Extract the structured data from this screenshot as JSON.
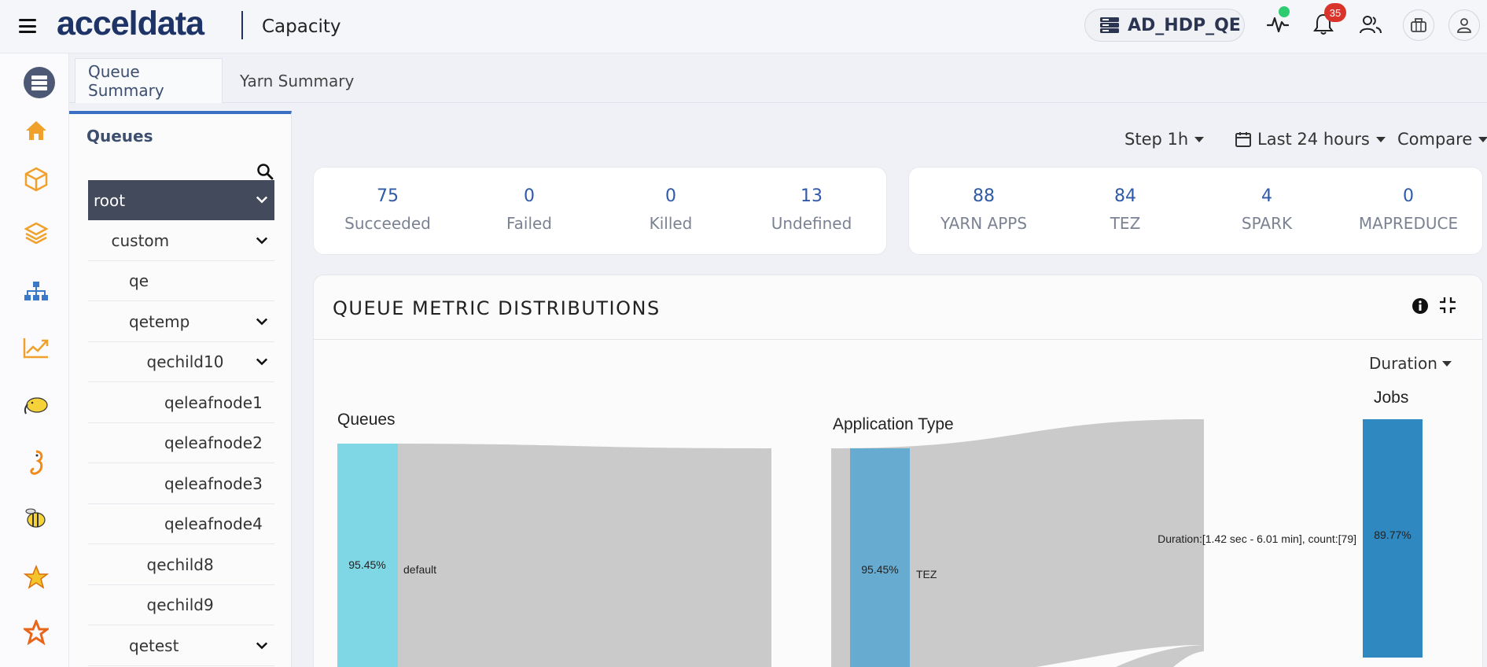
{
  "header": {
    "logo_text": "acceldata",
    "app_title": "Capacity",
    "cluster_name": "AD_HDP_QE",
    "notification_count": "35"
  },
  "tabs": [
    {
      "label": "Queue Summary",
      "active": true
    },
    {
      "label": "Yarn Summary",
      "active": false
    }
  ],
  "queues": {
    "title": "Queues",
    "tree": [
      {
        "label": "root",
        "depth": 0,
        "expandable": true,
        "selected": true
      },
      {
        "label": "custom",
        "depth": 1,
        "expandable": true
      },
      {
        "label": "qe",
        "depth": 2,
        "expandable": false
      },
      {
        "label": "qetemp",
        "depth": 2,
        "expandable": true
      },
      {
        "label": "qechild10",
        "depth": 3,
        "expandable": true
      },
      {
        "label": "qeleafnode1",
        "depth": 4,
        "expandable": false
      },
      {
        "label": "qeleafnode2",
        "depth": 4,
        "expandable": false
      },
      {
        "label": "qeleafnode3",
        "depth": 4,
        "expandable": false
      },
      {
        "label": "qeleafnode4",
        "depth": 4,
        "expandable": false
      },
      {
        "label": "qechild8",
        "depth": 3,
        "expandable": false
      },
      {
        "label": "qechild9",
        "depth": 3,
        "expandable": false
      },
      {
        "label": "qetest",
        "depth": 2,
        "expandable": true
      }
    ]
  },
  "controls": {
    "step": "Step 1h",
    "range": "Last 24 hours",
    "compare": "Compare"
  },
  "status_stats": [
    {
      "value": "75",
      "label": "Succeeded"
    },
    {
      "value": "0",
      "label": "Failed"
    },
    {
      "value": "0",
      "label": "Killed"
    },
    {
      "value": "13",
      "label": "Undefined"
    }
  ],
  "app_stats": [
    {
      "value": "88",
      "label": "YARN APPS"
    },
    {
      "value": "84",
      "label": "TEZ"
    },
    {
      "value": "4",
      "label": "SPARK"
    },
    {
      "value": "0",
      "label": "MAPREDUCE"
    }
  ],
  "metric": {
    "title": "QUEUE METRIC DISTRIBUTIONS",
    "dropdown": "Duration",
    "columns": {
      "queues": "Queues",
      "app_type": "Application Type",
      "jobs": "Jobs"
    },
    "nodes": {
      "queue_pct": "95.45%",
      "queue_name": "default",
      "app_pct": "95.45%",
      "app_name": "TEZ",
      "job_pct": "89.77%",
      "job_label": "Duration:[1.42 sec - 6.01 min], count:[79]"
    },
    "colors": {
      "queue": "#7fd6e4",
      "app": "#67abd0",
      "job": "#2f88bf",
      "link": "#cacaca"
    }
  }
}
